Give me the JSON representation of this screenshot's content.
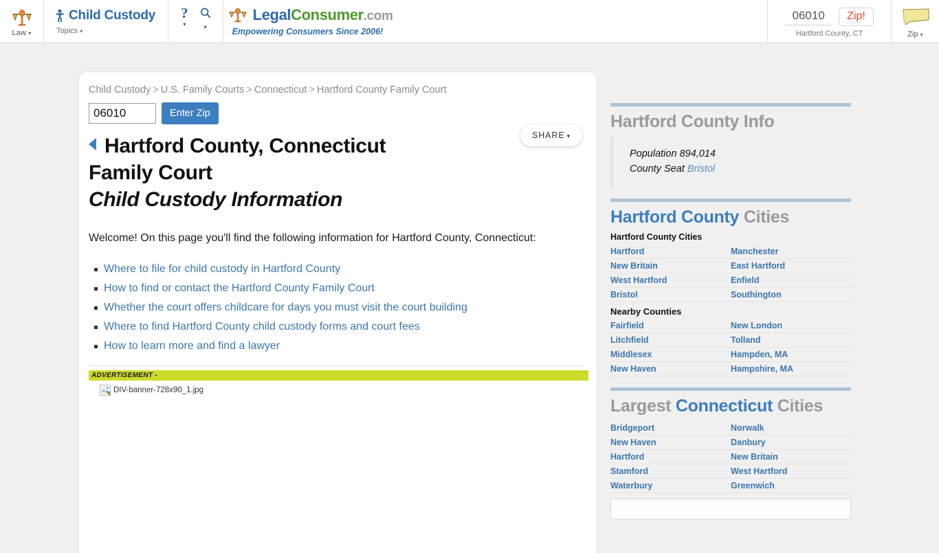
{
  "topnav": {
    "law": {
      "label": "Law",
      "icon": "scales-of-justice-icon",
      "caret": "▾"
    },
    "practice": {
      "title": "Child Custody",
      "sub_label": "Topics",
      "icon": "child-person-icon",
      "caret": "▾"
    },
    "help_icon": "question-mark-icon",
    "search_icon": "search-icon",
    "brand": {
      "part1": "Legal",
      "part2": "Consumer",
      "part3": ".com",
      "tagline": "Empowering Consumers Since 2006!",
      "icon": "scales-of-justice-icon"
    },
    "zipwidget": {
      "value": "06010",
      "placeholder": "Zip",
      "button": "Zip!",
      "county_label": "Hartford County, CT"
    },
    "state": {
      "label": "Zip",
      "caret": "▾",
      "icon": "connecticut-state-icon"
    }
  },
  "card": {
    "breadcrumb": [
      "Child Custody",
      "U.S. Family Courts",
      "Connecticut",
      "Hartford County Family Court"
    ],
    "breadcrumb_separator": ">",
    "zipform": {
      "value": "06010",
      "placeholder": "Enter Zip",
      "button": "Enter Zip"
    },
    "share": {
      "label": "SHARE",
      "caret": "▾"
    },
    "title_line1": "Hartford County, Connecticut",
    "title_line2": "Family Court",
    "title_line3": "Child Custody Information",
    "intro": "Welcome! On this page you'll find the following information for Hartford County, Connecticut:",
    "topics": [
      "Where to file for child custody in Hartford County",
      "How to find or contact the Hartford County Family Court",
      "Whether the court offers childcare for days you must visit the court building",
      "Where to find Hartford County child custody forms and court fees",
      "How to learn more and find a lawyer"
    ],
    "ad": {
      "label": "ADVERTISEMENT -",
      "image_alt": "DIV-banner-728x90_1.jpg",
      "bar_color": "#ccdb2c"
    }
  },
  "sidebar": {
    "county_info": {
      "heading": "Hartford County Info",
      "population_label": "Population",
      "population_value": "894,014",
      "seat_label": "County Seat",
      "seat_value": "Bristol"
    },
    "county_cities": {
      "heading_blue": "Hartford County",
      "heading_gray": "Cities",
      "caption": "Hartford County Cities",
      "rows": [
        [
          "Hartford",
          "Manchester"
        ],
        [
          "New Britain",
          "East Hartford"
        ],
        [
          "West Hartford",
          "Enfield"
        ],
        [
          "Bristol",
          "Southington"
        ]
      ],
      "nearby_label": "Nearby Counties",
      "nearby_rows": [
        [
          "Fairfield",
          "New London"
        ],
        [
          "Litchfield",
          "Tolland"
        ],
        [
          "Middlesex",
          "Hampden, MA"
        ],
        [
          "New Haven",
          "Hampshire, MA"
        ]
      ]
    },
    "largest_cities": {
      "heading_gray1": "Largest",
      "heading_blue": "Connecticut",
      "heading_gray2": "Cities",
      "rows": [
        [
          "Bridgeport",
          "Norwalk"
        ],
        [
          "New Haven",
          "Danbury"
        ],
        [
          "Hartford",
          "New Britain"
        ],
        [
          "Stamford",
          "West Hartford"
        ],
        [
          "Waterbury",
          "Greenwich"
        ]
      ]
    }
  },
  "colors": {
    "link_blue": "#3d76ad",
    "brand_blue": "#2c6bb0",
    "brand_green": "#4c9a2a",
    "accent_red": "#e2452e",
    "rule_blue": "#aec3d4",
    "ad_green": "#ccdb2c"
  }
}
